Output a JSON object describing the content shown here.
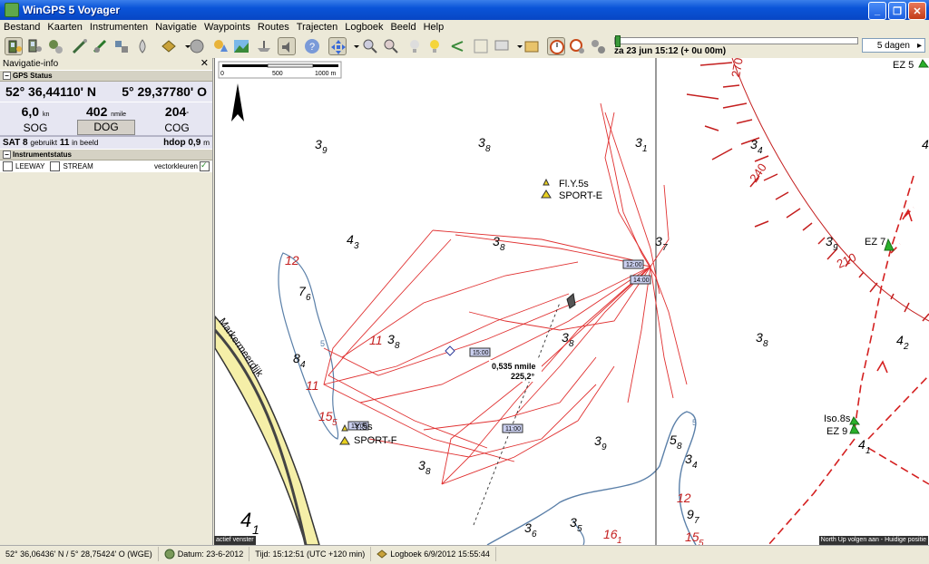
{
  "window": {
    "title": "WinGPS 5 Voyager"
  },
  "menu": [
    "Bestand",
    "Kaarten",
    "Instrumenten",
    "Navigatie",
    "Waypoints",
    "Routes",
    "Trajecten",
    "Logboek",
    "Beeld",
    "Help"
  ],
  "toolbar": {
    "timeline_label": "za 23 jun 15:12  (+ 0u 00m)",
    "duration": "5 dagen",
    "timeline_position": 0.0
  },
  "navpanel": {
    "title": "Navigatie-info",
    "gps_section": "GPS Status",
    "lat": "52° 36,44110' N",
    "lon": "5° 29,37780' O",
    "sog_value": "6,0",
    "sog_unit": "kn",
    "dog_value": "402",
    "dog_unit": "nmile",
    "cog_value": "204",
    "cog_unit": "°",
    "sog_label": "SOG",
    "dog_label": "DOG",
    "cog_label": "COG",
    "sat_prefix": "SAT",
    "sat_used": "8",
    "sat_used_label": "gebruikt",
    "sat_view": "11",
    "sat_view_label": "in beeld",
    "hdop": "hdop 0,9",
    "hdop_unit": "m",
    "instr_section": "Instrumentstatus",
    "leeway": "LEEWAY",
    "stream": "STREAM",
    "vectorkleuren": "vectorkleuren"
  },
  "map": {
    "scale": {
      "zero": "0",
      "mid": "500",
      "end": "1000 m"
    },
    "depths": [
      {
        "v": "3",
        "s": "9"
      },
      {
        "v": "3",
        "s": "8"
      },
      {
        "v": "3",
        "s": "1"
      },
      {
        "v": "3",
        "s": "4"
      },
      {
        "v": "4",
        "s": "3"
      },
      {
        "v": "3",
        "s": "8"
      },
      {
        "v": "3",
        "s": "7"
      },
      {
        "v": "3",
        "s": "9"
      },
      {
        "v": "7",
        "s": "6"
      },
      {
        "v": "3",
        "s": "8"
      },
      {
        "v": "3",
        "s": "8"
      },
      {
        "v": "8",
        "s": "4"
      },
      {
        "v": "3",
        "s": "8"
      },
      {
        "v": "4",
        "s": "2"
      },
      {
        "v": "5",
        "s": "8"
      },
      {
        "v": "3",
        "s": "9"
      },
      {
        "v": "3",
        "s": "4"
      },
      {
        "v": "3",
        "s": "8"
      },
      {
        "v": "9",
        "s": "7"
      },
      {
        "v": "3",
        "s": "6"
      },
      {
        "v": "3",
        "s": "5"
      },
      {
        "v": "4",
        "s": "1"
      },
      {
        "v": "4",
        "s": "1"
      },
      {
        "v": "4",
        "s": ""
      }
    ],
    "red_depths": [
      {
        "v": "12",
        "s": ""
      },
      {
        "v": "11",
        "s": ""
      },
      {
        "v": "11",
        "s": ""
      },
      {
        "v": "15",
        "s": "5"
      },
      {
        "v": "12",
        "s": ""
      },
      {
        "v": "16",
        "s": "1"
      },
      {
        "v": "15",
        "s": "5"
      }
    ],
    "buoys": [
      {
        "line1": "Fl.Y.5s",
        "line2": "SPORT-E"
      },
      {
        "line1": "Y.5s",
        "line2": "SPORT-F"
      }
    ],
    "ez_labels": [
      "EZ 5",
      "EZ 7",
      "Iso.8s",
      "EZ 9"
    ],
    "dike_label": "Markermeerdijk",
    "time_tags": [
      "12:00",
      "14:00",
      "15:00",
      "11:00",
      "13:00"
    ],
    "bearing_distance": "0,535 nmile",
    "bearing_angle": "225,2°",
    "compass_labels": [
      "270",
      "240",
      "210"
    ],
    "contour_label": "5",
    "contour_label2": "5",
    "footer_left": "actief venster",
    "footer_right": "North Up volgen aan - Huidige positie"
  },
  "status": {
    "coords": "52° 36,06436' N / 5° 28,75424' O (WGE)",
    "datum": "Datum: 23-6-2012",
    "tijd": "Tijd: 15:12:51 (UTC +120 min)",
    "logboek": "Logboek 6/9/2012 15:55:44"
  }
}
